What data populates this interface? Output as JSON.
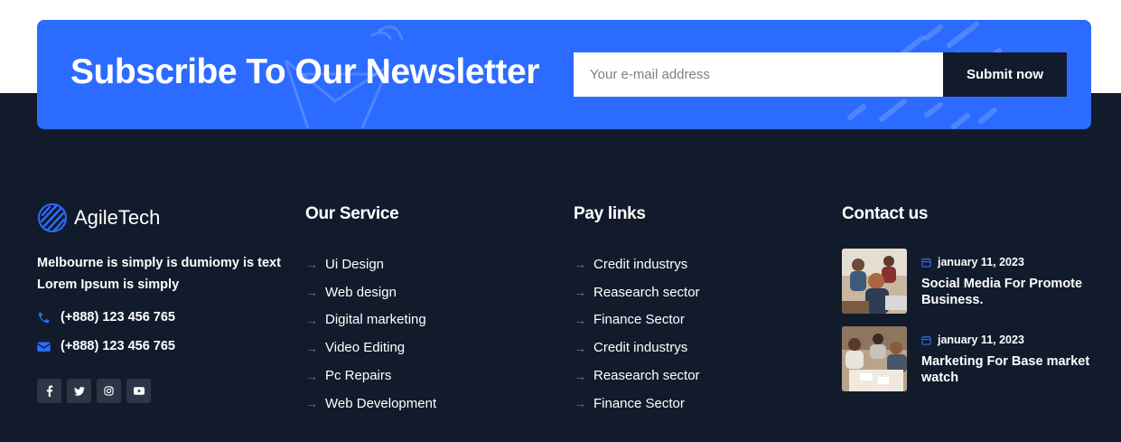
{
  "newsletter": {
    "title": "Subscribe To Our Newsletter",
    "email_placeholder": "Your e-mail address",
    "submit_label": "Submit now"
  },
  "brand": {
    "name": "AgileTech",
    "about": "Melbourne is simply is dumiomy is text Lorem Ipsum is simply",
    "phone": "(+888) 123 456 765",
    "email": "(+888) 123 456 765",
    "socials": [
      "facebook-icon",
      "twitter-icon",
      "instagram-icon",
      "youtube-icon"
    ]
  },
  "services": {
    "title": "Our Service",
    "items": [
      "Ui Design",
      "Web design",
      "Digital marketing",
      "Video Editing",
      "Pc Repairs",
      "Web Development"
    ]
  },
  "paylinks": {
    "title": "Pay links",
    "items": [
      "Credit industrys",
      "Reasearch sector",
      "Finance Sector",
      "Credit industrys",
      "Reasearch sector",
      "Finance Sector"
    ]
  },
  "contact": {
    "title": "Contact us",
    "posts": [
      {
        "date": "january 11, 2023",
        "title": "Social Media For Promote Business."
      },
      {
        "date": "january 11, 2023",
        "title": "Marketing For Base market watch"
      }
    ]
  },
  "colors": {
    "accent": "#2b6bff",
    "footer_bg": "#121b2b",
    "social_bg": "#2c3646"
  }
}
